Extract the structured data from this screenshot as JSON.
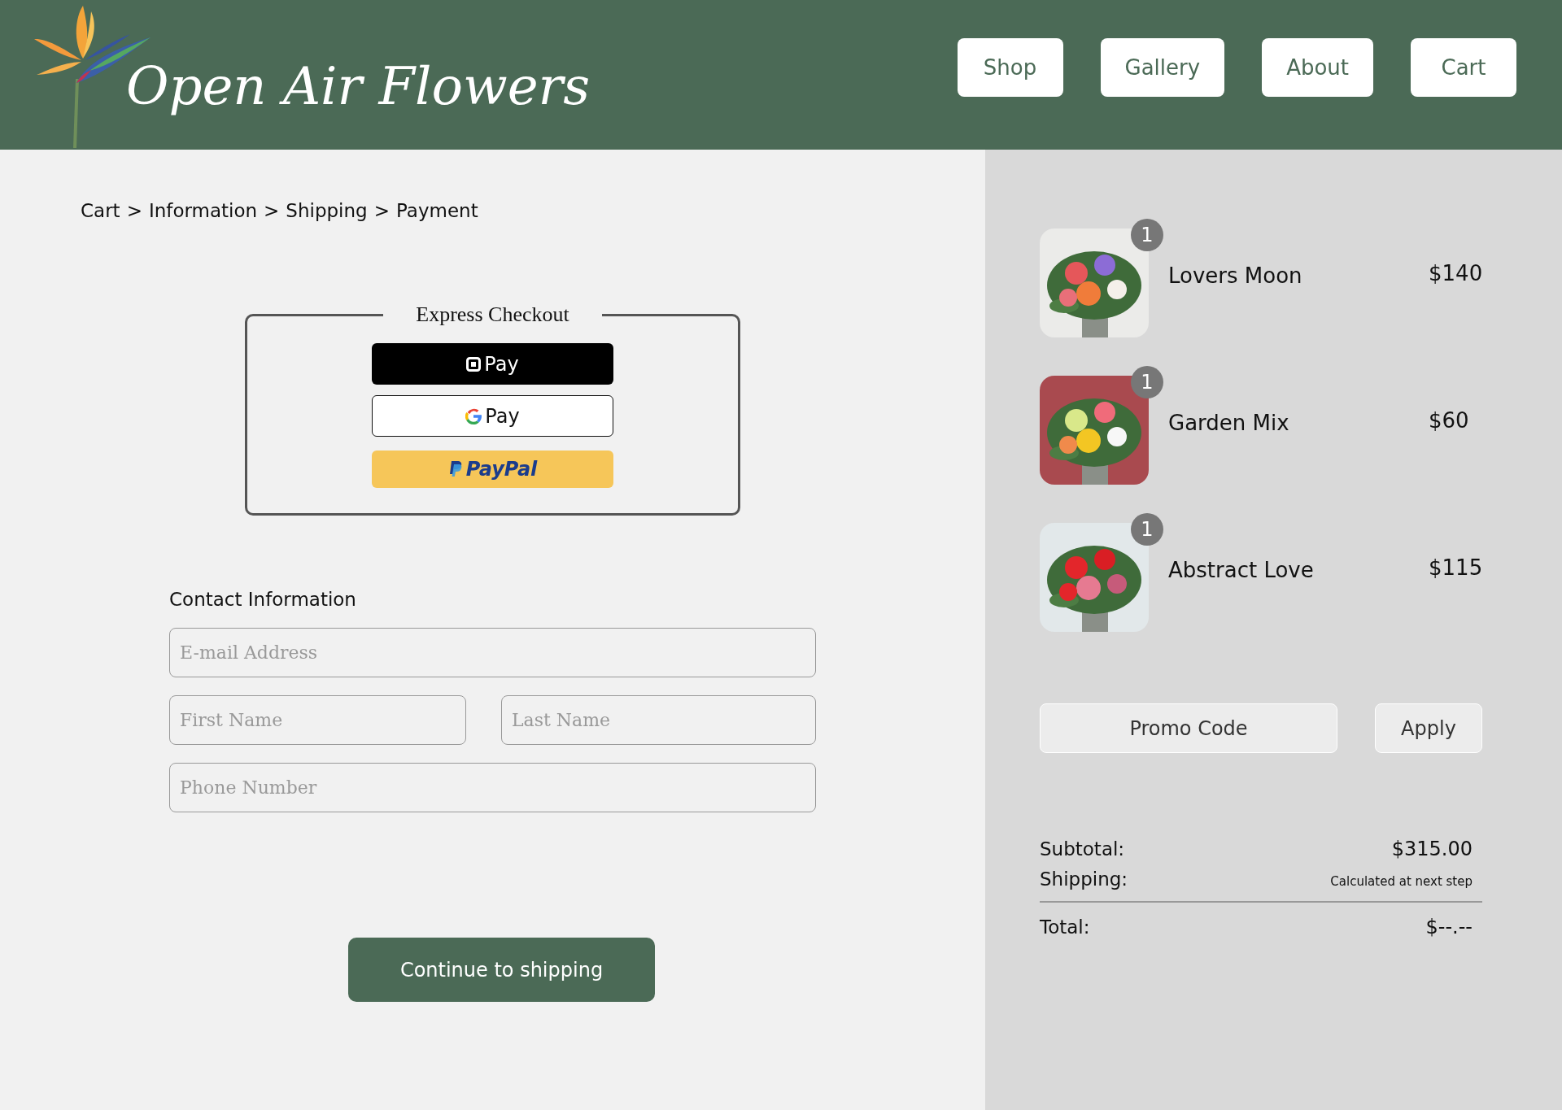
{
  "header": {
    "logo_text": "Open Air Flowers",
    "nav": [
      {
        "label": "Shop"
      },
      {
        "label": "Gallery"
      },
      {
        "label": "About"
      },
      {
        "label": "Cart"
      }
    ]
  },
  "breadcrumb": [
    "Cart",
    "Information",
    "Shipping",
    "Payment"
  ],
  "breadcrumb_separator": ">",
  "express_checkout": {
    "title": "Express Checkout",
    "buttons": [
      {
        "kind": "square",
        "label": "Pay"
      },
      {
        "kind": "google",
        "label": "Pay"
      },
      {
        "kind": "paypal",
        "label": "PayPal"
      }
    ]
  },
  "contact": {
    "title": "Contact Information",
    "fields": [
      {
        "placeholder": "E-mail Address",
        "kind": "full"
      },
      {
        "placeholder": "First Name",
        "kind": "half"
      },
      {
        "placeholder": "Last Name",
        "kind": "half"
      },
      {
        "placeholder": "Phone Number",
        "kind": "full"
      }
    ]
  },
  "continue_button": "Continue to shipping",
  "cart_items": [
    {
      "name": "Lovers Moon",
      "price": "$140",
      "quantity": "1"
    },
    {
      "name": "Garden Mix",
      "price": "$60",
      "quantity": "1"
    },
    {
      "name": "Abstract Love",
      "price": "$115",
      "quantity": "1"
    }
  ],
  "promo": {
    "placeholder": "Promo Code",
    "button": "Apply"
  },
  "summary": {
    "subtotal_label": "Subtotal:",
    "subtotal": "$315.00",
    "shipping_label": "Shipping:",
    "shipping": "Calculated at next step",
    "total_label": "Total:",
    "total": "$--.--"
  }
}
